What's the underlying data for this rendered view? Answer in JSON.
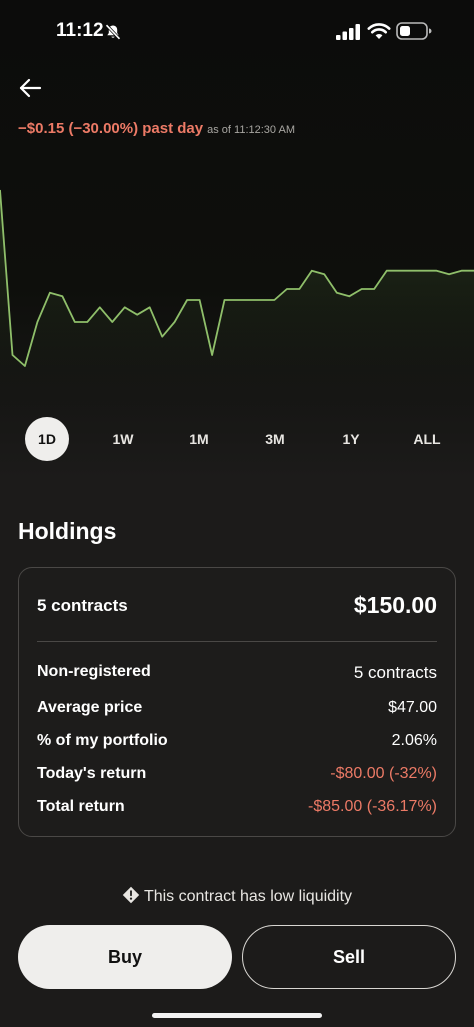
{
  "status_bar": {
    "time": "11:12",
    "icons": [
      "bell-muted-icon",
      "signal-icon",
      "wifi-icon",
      "battery-icon"
    ]
  },
  "header": {
    "back_icon": "arrow-left-icon",
    "change_text": "−$0.15 (−30.00%) past day",
    "as_of_text": "as of 11:12:30 AM"
  },
  "colors": {
    "positive_line": "#8fbf6a",
    "negative_text": "#ec7a66",
    "background": "#1c1b1a"
  },
  "chart_data": {
    "type": "line",
    "y": [
      0.3,
      0.075,
      0.06,
      0.12,
      0.16,
      0.155,
      0.12,
      0.12,
      0.14,
      0.12,
      0.14,
      0.13,
      0.14,
      0.1,
      0.12,
      0.15,
      0.15,
      0.075,
      0.15,
      0.15,
      0.15,
      0.15,
      0.15,
      0.165,
      0.165,
      0.19,
      0.185,
      0.16,
      0.155,
      0.165,
      0.165,
      0.19,
      0.19,
      0.19,
      0.19,
      0.19,
      0.185,
      0.19,
      0.19
    ],
    "ylim": [
      0,
      0.3
    ],
    "title": "",
    "xlabel": "",
    "ylabel": "",
    "grid": false
  },
  "ranges": {
    "items": [
      "1D",
      "1W",
      "1M",
      "3M",
      "1Y",
      "ALL"
    ],
    "active": "1D"
  },
  "holdings": {
    "title": "Holdings",
    "contracts_label": "5 contracts",
    "market_value": "$150.00",
    "rows": [
      {
        "label": "Non-registered",
        "value": "5 contracts"
      },
      {
        "label": "Average price",
        "value": "$47.00"
      },
      {
        "label": "% of my portfolio",
        "value": "2.06%"
      },
      {
        "label": "Today's return",
        "value": "-$80.00 (-32%)"
      },
      {
        "label": "Total return",
        "value": "-$85.00 (-36.17%)"
      }
    ]
  },
  "notice": {
    "icon": "warning-icon",
    "text": "This contract has low liquidity"
  },
  "actions": {
    "buy_label": "Buy",
    "sell_label": "Sell"
  }
}
